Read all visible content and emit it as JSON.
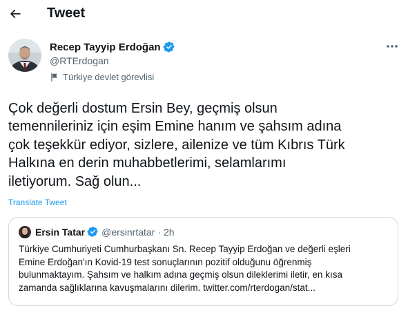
{
  "header": {
    "title": "Tweet",
    "back_icon": "arrow-left-icon"
  },
  "tweet": {
    "author": {
      "name": "Recep Tayyip Erdoğan",
      "handle": "@RTErdogan",
      "verified": true,
      "label": "Türkiye devlet görevlisi"
    },
    "text": "Çok değerli dostum Ersin Bey, geçmiş olsun\ntemennileriniz için eşim Emine hanım ve şahsım adına\nçok teşekkür ediyor, sizlere, ailenize ve tüm Kıbrıs Türk\nHalkına en derin muhabbetlerimi, selamlarımı\niletiyorum. Sağ olun...",
    "translate_label": "Translate Tweet",
    "more_icon": "more-horizontal-icon"
  },
  "quote": {
    "author": {
      "name": "Ersin Tatar",
      "handle": "@ersinrtatar",
      "separator": "·",
      "time": "2h",
      "verified": true
    },
    "text": "Türkiye Cumhuriyeti Cumhurbaşkanı Sn. Recep Tayyip Erdoğan ve değerli eşleri\nEmine Erdoğan'ın Kovid-19 test sonuçlarının pozitif olduğunu öğrenmiş\nbulunmaktayım. Şahsım ve halkım adına geçmiş olsun dileklerimi iletir, en kısa\nzamanda sağlıklarına kavuşmalarını dilerim. twitter.com/rterdogan/stat..."
  },
  "colors": {
    "accent": "#1d9bf0",
    "text_primary": "#0f1419",
    "text_secondary": "#536471",
    "border": "#cfd9de"
  }
}
